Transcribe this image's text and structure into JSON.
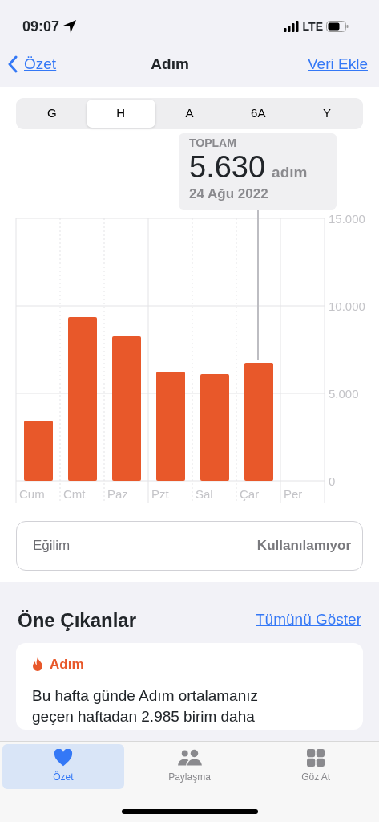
{
  "status_bar": {
    "time": "09:07",
    "network": "LTE"
  },
  "nav": {
    "back": "Özet",
    "title": "Adım",
    "action": "Veri Ekle"
  },
  "segments": [
    {
      "label": "G",
      "selected": false
    },
    {
      "label": "H",
      "selected": true
    },
    {
      "label": "A",
      "selected": false
    },
    {
      "label": "6A",
      "selected": false
    },
    {
      "label": "Y",
      "selected": false
    }
  ],
  "tooltip": {
    "label": "TOPLAM",
    "value": "5.630",
    "unit": "adım",
    "date": "24 Ağu 2022"
  },
  "chart_data": {
    "type": "bar",
    "categories": [
      "Cum",
      "Cmt",
      "Paz",
      "Pzt",
      "Sal",
      "Çar",
      "Per"
    ],
    "series": [
      {
        "color": "#e8582a",
        "values": [
          3440,
          9360,
          8260,
          6240,
          6100,
          6740,
          null
        ]
      }
    ],
    "ylim": [
      0,
      15000
    ],
    "yticks": [
      {
        "value": 0,
        "label": "0"
      },
      {
        "value": 5000,
        "label": "5.000"
      },
      {
        "value": 10000,
        "label": "10.000"
      },
      {
        "value": 15000,
        "label": "15.000"
      }
    ]
  },
  "trend": {
    "label": "Eğilim",
    "value": "Kullanılamıyor"
  },
  "highlights": {
    "title": "Öne Çıkanlar",
    "link": "Tümünü Göster",
    "card": {
      "category": "Adım",
      "text": "Bu hafta günde Adım ortalamanız geçen haftadan 2.985 birim daha"
    }
  },
  "tab_bar": [
    {
      "label": "Özet",
      "kind": "heart",
      "selected": true
    },
    {
      "label": "Paylaşma",
      "kind": "people",
      "selected": false
    },
    {
      "label": "Göz At",
      "kind": "grid",
      "selected": false
    }
  ]
}
